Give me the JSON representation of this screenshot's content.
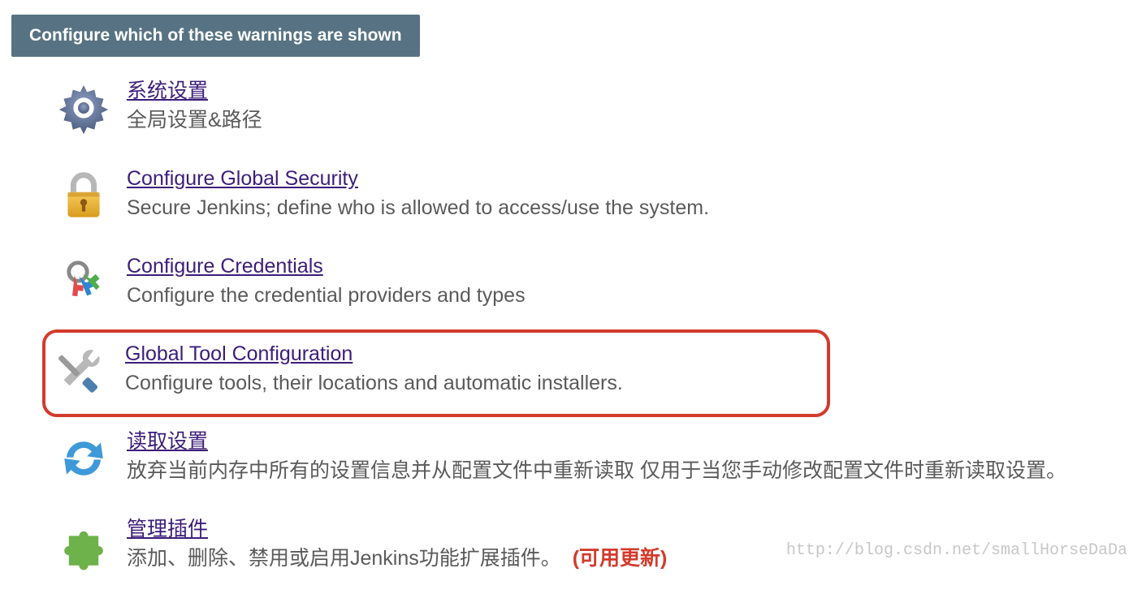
{
  "banner": {
    "text": "Configure which of these warnings are shown"
  },
  "items": [
    {
      "id": "system-config",
      "title": "系统设置",
      "desc": "全局设置&路径",
      "highlighted": false
    },
    {
      "id": "global-security",
      "title": "Configure Global Security",
      "desc": "Secure Jenkins; define who is allowed to access/use the system.",
      "highlighted": false
    },
    {
      "id": "configure-credentials",
      "title": "Configure Credentials",
      "desc": "Configure the credential providers and types",
      "highlighted": false
    },
    {
      "id": "global-tool-configuration",
      "title": "Global Tool Configuration",
      "desc": "Configure tools, their locations and automatic installers.",
      "highlighted": true
    },
    {
      "id": "reload-config",
      "title": "读取设置",
      "desc": "放弃当前内存中所有的设置信息并从配置文件中重新读取 仅用于当您手动修改配置文件时重新读取设置。",
      "highlighted": false
    },
    {
      "id": "manage-plugins",
      "title": "管理插件",
      "desc": "添加、删除、禁用或启用Jenkins功能扩展插件。",
      "badge": "(可用更新)",
      "highlighted": false
    }
  ],
  "watermark": "http://blog.csdn.net/smallHorseDaDa"
}
